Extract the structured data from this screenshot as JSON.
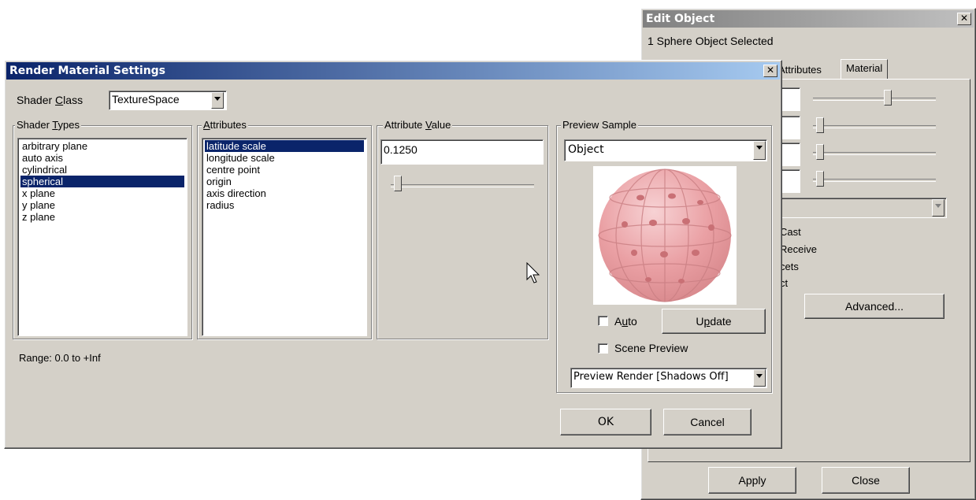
{
  "edit_object": {
    "title": "Edit Object",
    "selected_text": "1 Sphere Object Selected",
    "tabs": [
      {
        "label": "Attributes"
      },
      {
        "label": "Material"
      }
    ],
    "checkbox_fragments": [
      "Cast",
      "Receive",
      "cets",
      "ct"
    ],
    "advanced_label": "Advanced...",
    "apply_label": "Apply",
    "close_label": "Close"
  },
  "render_dialog": {
    "title": "Render Material Settings",
    "shader_class_label_pre": "Shader ",
    "shader_class_label_ul": "C",
    "shader_class_label_post": "lass",
    "shader_class_value": "TextureSpace",
    "shader_types_label_pre": "Shader ",
    "shader_types_label_ul": "T",
    "shader_types_label_post": "ypes",
    "shader_types": [
      "arbitrary plane",
      "auto axis",
      "cylindrical",
      "spherical",
      "x plane",
      "y plane",
      "z plane"
    ],
    "shader_types_selected_index": 3,
    "attributes_label_ul": "A",
    "attributes_label_post": "ttributes",
    "attributes": [
      "latitude scale",
      "longitude scale",
      "centre point",
      "origin",
      "axis direction",
      "radius"
    ],
    "attributes_selected_index": 0,
    "attribute_value_label_pre": "Attribute ",
    "attribute_value_label_ul": "V",
    "attribute_value_label_post": "alue",
    "attribute_value": "0.1250",
    "preview_label": "Preview Sample",
    "preview_object": "Object",
    "auto_label_pre": "A",
    "auto_label_ul": "u",
    "auto_label_post": "to",
    "update_label_pre": "U",
    "update_label_ul": "p",
    "update_label_post": "date",
    "scene_preview_label": "Scene Preview",
    "preview_render": "Preview Render [Shadows Off]",
    "range_text": "Range: 0.0 to +Inf",
    "ok_label": "OK",
    "cancel_label": "Cancel"
  },
  "colors": {
    "titlebar_active": "#0a246a",
    "selection": "#0a246a",
    "face": "#d4d0c8",
    "sphere": "#e9a0a4"
  }
}
